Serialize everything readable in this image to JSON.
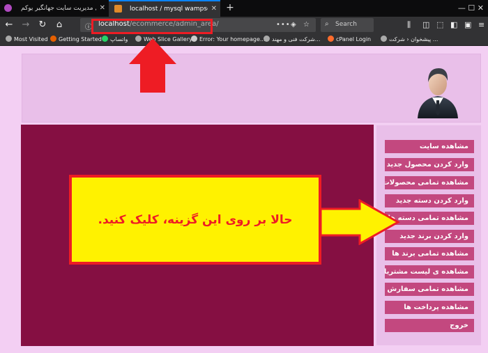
{
  "browser": {
    "tabs": [
      {
        "title": "پنل مدیریت سایت جهانگیر یوکم",
        "active": false
      },
      {
        "title": "localhost / mysql wampserver | ph",
        "active": true
      }
    ],
    "new_tab_label": "+",
    "window_controls": "—   ☐   ✕",
    "url_host": "localhost",
    "url_path": "/ecommerce/admin_area/",
    "url_actions": "•••",
    "search_placeholder": "Search",
    "bookmarks": [
      "Most Visited",
      "Getting Started",
      "واتساپ",
      "Web Slice Gallery",
      "Error: Your homepage...",
      "شرکت فنی و مهند...",
      "cPanel Login",
      "پیشخوان ‹ شرکت ..."
    ]
  },
  "admin": {
    "menu": [
      "مشاهده سایت",
      "وارد کردن محصول جدید",
      "مشاهده تمامی محصولات",
      "وارد کردن دسته جدید",
      "مشاهده تمامی دسته ها",
      "وارد کردن برند جدید",
      "مشاهده تمامی برند ها",
      "مشاهده ی لیست مشتریان",
      "مشاهده تمامی سفارش ها",
      "مشاهده پرداخت ها",
      "خروج"
    ]
  },
  "annotation": {
    "instruction": "حالا بر روی این گزینه، کلیک کنید."
  },
  "colors": {
    "page_bg": "#f3cff3",
    "header_bg": "#e9bfe9",
    "content_bg": "#850f42",
    "menu_item_bg": "#c3487f",
    "highlight_red": "#ee1c24",
    "callout_yellow": "#fff200"
  }
}
